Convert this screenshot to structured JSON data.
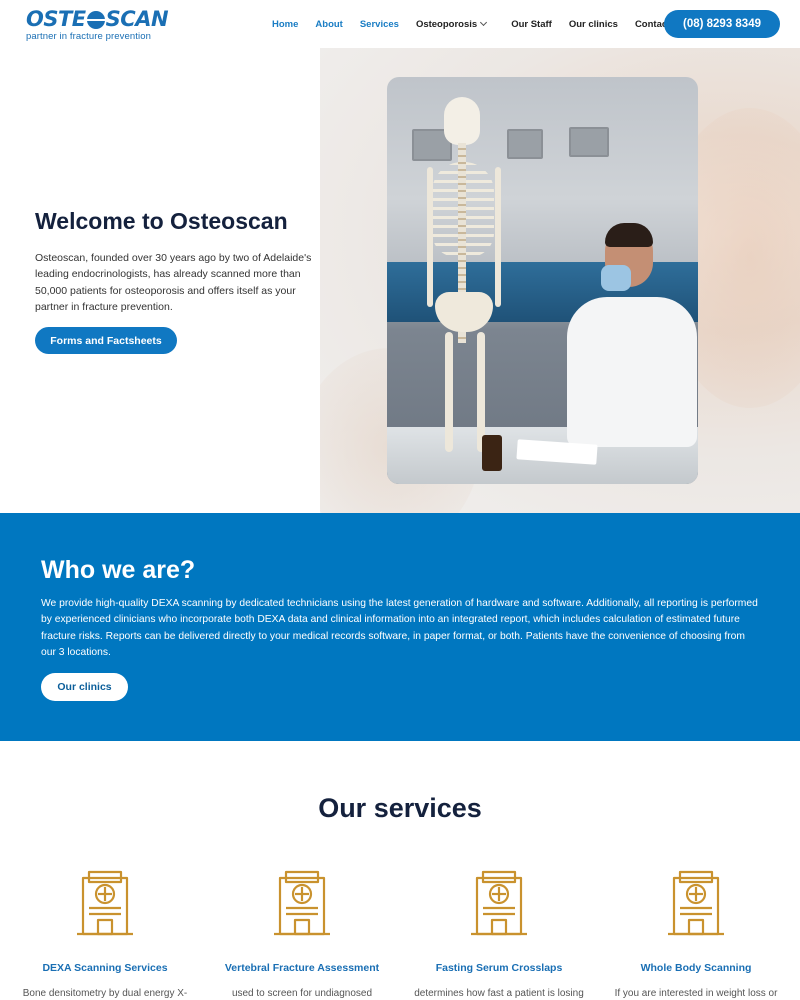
{
  "header": {
    "logo_text_left": "OSTE",
    "logo_text_right": "SCAN",
    "logo_tagline": "partner in fracture prevention",
    "nav": [
      {
        "label": "Home"
      },
      {
        "label": "About"
      },
      {
        "label": "Services"
      },
      {
        "label": "Osteoporosis"
      },
      {
        "label": "Our Staff"
      },
      {
        "label": "Our clinics"
      },
      {
        "label": "Contact"
      }
    ],
    "phone": "(08) 8293 8349"
  },
  "hero": {
    "title": "Welcome to Osteoscan",
    "text": "Osteoscan, founded over 30 years ago by two of Adelaide's leading endocrinologists, has already scanned more than 50,000 patients for osteoporosis and offers itself as your partner in fracture prevention.",
    "button": "Forms and Factsheets"
  },
  "who": {
    "title": "Who we are?",
    "text": "We provide high-quality DEXA scanning by dedicated technicians using the latest generation of hardware and software. Additionally, all reporting is performed by experienced clinicians who incorporate both DEXA data and clinical information into an integrated report, which includes calculation of estimated future fracture risks. Reports can be delivered directly to your medical records software, in paper format, or both. Patients have the convenience of choosing from our 3 locations.",
    "button": "Our clinics"
  },
  "services": {
    "title": "Our services",
    "items": [
      {
        "title": "DEXA Scanning Services",
        "text": "Bone densitometry by dual energy X-"
      },
      {
        "title": "Vertebral Fracture Assessment",
        "text": "used to screen for undiagnosed"
      },
      {
        "title": "Fasting Serum Crosslaps",
        "text": "determines how fast a patient is losing"
      },
      {
        "title": "Whole Body Scanning",
        "text": "If you are interested in weight loss or"
      }
    ]
  },
  "colors": {
    "brand_blue": "#0077c0",
    "heading_navy": "#14213d",
    "icon_gold": "#c9922e"
  }
}
